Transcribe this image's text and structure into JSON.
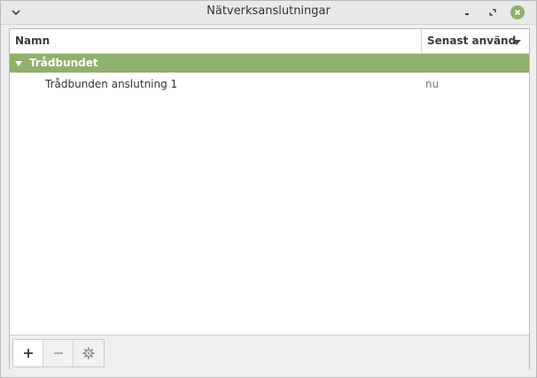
{
  "window": {
    "title": "Nätverksanslutningar"
  },
  "titlebar_icons": {
    "menu": "chevron-down-icon",
    "minimize": "minimize-icon",
    "maximize": "maximize-icon",
    "close": "close-icon"
  },
  "table": {
    "columns": [
      "Namn",
      "Senast använd"
    ],
    "sort_column": "Senast använd",
    "groups": [
      {
        "label": "Trådbundet",
        "expanded": true,
        "rows": [
          {
            "name": "Trådbunden anslutning 1",
            "last_used": "nu"
          }
        ]
      }
    ]
  },
  "toolbar": {
    "buttons": [
      {
        "icon": "plus-icon",
        "enabled": true
      },
      {
        "icon": "minus-icon",
        "enabled": false
      },
      {
        "icon": "gear-icon",
        "enabled": false
      }
    ]
  },
  "colors": {
    "accent": "#8fb16b",
    "last_used_text": "#6f7b8a"
  }
}
